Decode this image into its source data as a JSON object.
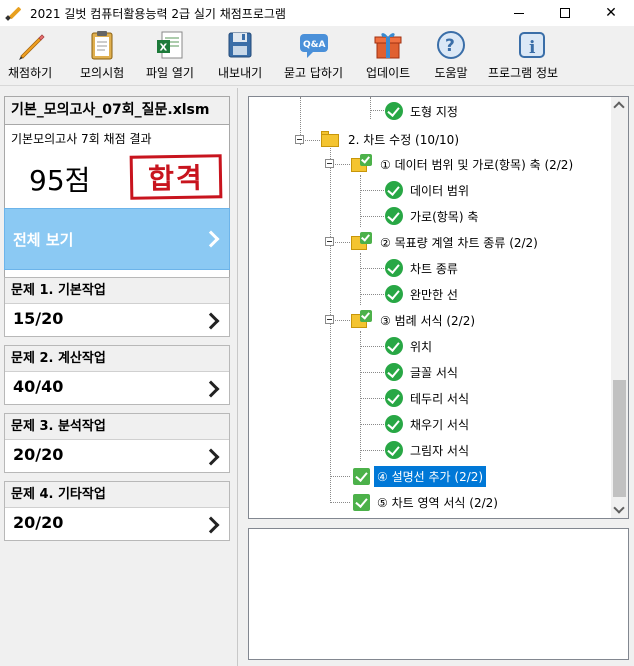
{
  "window": {
    "title": "2021 길벗 컴퓨터활용능력 2급 실기 채점프로그램"
  },
  "toolbar": {
    "items": [
      {
        "label": "채점하기",
        "icon": "pencil-icon"
      },
      {
        "label": "모의시험",
        "icon": "clipboard-icon"
      },
      {
        "label": "파일 열기",
        "icon": "excel-file-icon"
      },
      {
        "label": "내보내기",
        "icon": "floppy-disk-icon"
      },
      {
        "label": "묻고 답하기",
        "icon": "qa-bubble-icon"
      },
      {
        "label": "업데이트",
        "icon": "gift-icon"
      },
      {
        "label": "도움말",
        "icon": "help-icon"
      },
      {
        "label": "프로그램 정보",
        "icon": "info-icon"
      }
    ]
  },
  "file": {
    "name": "기본_모의고사_07회_질문.xlsm",
    "result_label": "기본모의고사 7회 채점 결과",
    "score": "95점",
    "stamp": "합격"
  },
  "nav": {
    "all_label": "전체 보기"
  },
  "problems": [
    {
      "title": "문제 1. 기본작업",
      "score": "15/20"
    },
    {
      "title": "문제 2. 계산작업",
      "score": "40/40"
    },
    {
      "title": "문제 3. 분석작업",
      "score": "20/20"
    },
    {
      "title": "문제 4. 기타작업",
      "score": "20/20"
    }
  ],
  "tree": {
    "nodes": [
      {
        "label": "도형 지정"
      },
      {
        "label": "2. 차트 수정 (10/10)"
      },
      {
        "label": "① 데이터 범위 및 가로(항목) 축 (2/2)"
      },
      {
        "label": "데이터 범위"
      },
      {
        "label": "가로(항목) 축"
      },
      {
        "label": "② 목표량 계열 차트 종류 (2/2)"
      },
      {
        "label": "차트 종류"
      },
      {
        "label": "완만한 선"
      },
      {
        "label": "③ 범례 서식 (2/2)"
      },
      {
        "label": "위치"
      },
      {
        "label": "글꼴 서식"
      },
      {
        "label": "테두리 서식"
      },
      {
        "label": "채우기 서식"
      },
      {
        "label": "그림자 서식"
      },
      {
        "label": "④ 설명선 추가 (2/2)"
      },
      {
        "label": "⑤ 차트 영역 서식 (2/2)"
      }
    ]
  },
  "colors": {
    "accent": "#0078d7",
    "nav_all_bg": "#8bc9f3",
    "stamp_red": "#c8141e",
    "check_green": "#28a745"
  }
}
